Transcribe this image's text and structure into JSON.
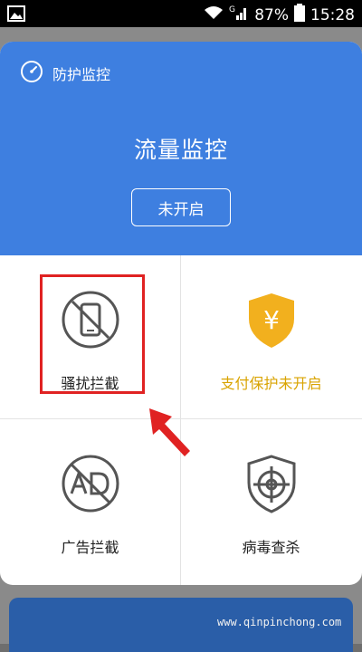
{
  "status_bar": {
    "battery": "87%",
    "time": "15:28"
  },
  "dialog": {
    "header": {
      "section_label": "防护监控",
      "title": "流量监控",
      "status_button": "未开启"
    },
    "items": [
      {
        "label": "骚扰拦截",
        "icon": "no-phone-icon"
      },
      {
        "label": "支付保护未开启",
        "icon": "yuan-shield-icon"
      },
      {
        "label": "广告拦截",
        "icon": "ad-block-icon"
      },
      {
        "label": "病毒查杀",
        "icon": "virus-scan-icon"
      }
    ]
  },
  "watermark": "www.qinpinchong.com",
  "colors": {
    "accent_blue": "#3e7fe0",
    "gold": "#f2b01e",
    "highlight_red": "#e02222"
  }
}
